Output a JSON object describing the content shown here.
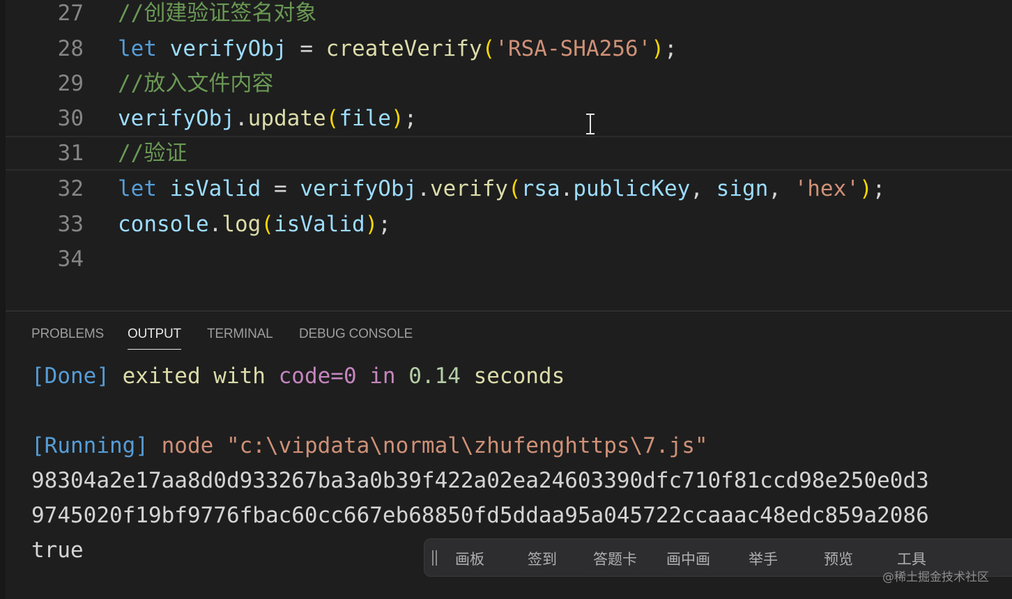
{
  "editor": {
    "lines": [
      {
        "num": "27",
        "comment": "//创建验证签名对象"
      },
      {
        "num": "28",
        "kw": "let",
        "var": "verifyObj",
        "eq": " = ",
        "fn": "createVerify",
        "open": "(",
        "str": "'RSA-SHA256'",
        "close": ")",
        "end": ";"
      },
      {
        "num": "29",
        "comment": "//放入文件内容"
      },
      {
        "num": "30",
        "obj": "verifyObj",
        "dot": ".",
        "fn": "update",
        "open": "(",
        "arg": "file",
        "close": ")",
        "end": ";"
      },
      {
        "num": "31",
        "comment": "//验证"
      },
      {
        "num": "32",
        "kw": "let",
        "var": "isValid",
        "eq": " = ",
        "obj": "verifyObj",
        "dot": ".",
        "fn": "verify",
        "open": "(",
        "a1": "rsa",
        "dot2": ".",
        "a2": "publicKey",
        "comma": ", ",
        "a3": "sign",
        "comma2": ", ",
        "str": "'hex'",
        "close": ")",
        "end": ";"
      },
      {
        "num": "33",
        "obj": "console",
        "dot": ".",
        "fn": "log",
        "open": "(",
        "arg": "isValid",
        "close": ")",
        "end": ";"
      },
      {
        "num": "34"
      }
    ]
  },
  "panel": {
    "tabs": [
      "PROBLEMS",
      "OUTPUT",
      "TERMINAL",
      "DEBUG CONSOLE"
    ],
    "active_tab": "OUTPUT",
    "output": {
      "done_tag": "[Done]",
      "done_exited": " exited with ",
      "done_code": "code=0",
      "done_in": " in ",
      "done_time": "0.14",
      "done_seconds": " seconds",
      "running_tag": "[Running]",
      "running_cmd": " node ",
      "running_path": "\"c:\\vipdata\\normal\\zhufenghttps\\7.js\"",
      "hash1": "98304a2e17aa8d0d933267ba3a0b39f422a02ea24603390dfc710f81ccd98e250e0d3",
      "hash2": "9745020f19bf9776fbac60cc667eb68850fd5ddaa95a045722ccaaac48edc859a2086",
      "result": "true"
    }
  },
  "floating_toolbar": {
    "items": [
      "画板",
      "签到",
      "答题卡",
      "画中画",
      "举手",
      "预览",
      "工具"
    ]
  },
  "watermark": "@稀土掘金技术社区"
}
